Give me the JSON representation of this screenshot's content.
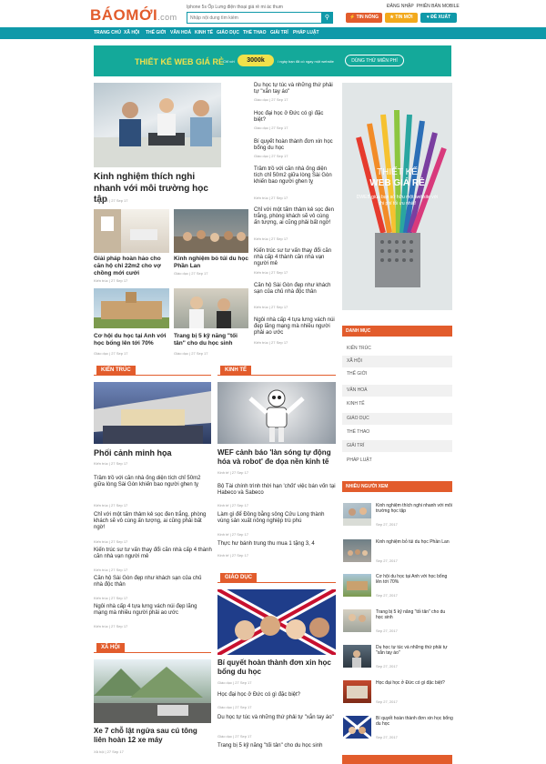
{
  "header": {
    "logo_main": "BÁOMỚI",
    "logo_suffix": ".com",
    "tagline": "Iphone 5s Ốp Lưng điện thoại giá rẻ mi ác thum",
    "search_placeholder": "Nhập nội dung tìm kiếm",
    "hot_btn": "TIN NÓNG",
    "new_btn": "TIN MỚI",
    "suggest_btn": "ĐỀ XUẤT",
    "login": "ĐĂNG NHẬP",
    "mobile": "PHIÊN BẢN MOBILE"
  },
  "nav": [
    "TRANG CHỦ",
    "XÃ HỘI",
    "THẾ GIỚI",
    "VĂN HOÁ",
    "KINH TẾ",
    "GIÁO DỤC",
    "THỂ THAO",
    "GIẢI TRÍ",
    "PHÁP LUẬT"
  ],
  "banner": {
    "title": "THIẾT KẾ WEB GIÁ RẺ",
    "from": "Chỉ với",
    "price": "3000k",
    "note": "/ ngày bạn đã có ngay một website",
    "cta": "DÙNG THỬ MIỄN PHÍ"
  },
  "featured": {
    "title": "Kinh nghiệm thích nghi nhanh với môi trường học tập",
    "meta": "Giáo dục  |  27 Sep 17"
  },
  "small_cards": [
    {
      "title": "Giải pháp hoàn hảo cho căn hộ chỉ 22m2 cho vợ chồng mới cưới",
      "meta": "Kiến trúc  |  27 Sep 17"
    },
    {
      "title": "Kinh nghiệm bỏ túi du học Phần Lan",
      "meta": "Giáo dục  |  27 Sep 17"
    },
    {
      "title": "Cơ hội du học tại Anh với học bổng lên tới 70%",
      "meta": "Giáo dục  |  27 Sep 17"
    },
    {
      "title": "Trang bị 5 kỹ năng \"tối tân\" cho du học sinh",
      "meta": "Giáo dục  |  27 Sep 17"
    }
  ],
  "mid_list": [
    {
      "title": "Du học tự túc và những thứ phải tự \"xắn tay áo\"",
      "meta": "Giáo dục  |  27 Sep 17"
    },
    {
      "title": "Học đại học ở Đức có gì đặc biệt?",
      "meta": "Giáo dục  |  27 Sep 17"
    },
    {
      "title": "Bí quyết hoàn thành đơn xin học bổng du học",
      "meta": "Giáo dục  |  27 Sep 17"
    },
    {
      "title": "Trầm trồ với căn nhà ống diện tích chỉ 50m2 giữa lòng Sài Gòn khiến bao người ghen tỵ",
      "meta": "Kiến trúc  |  27 Sep 17"
    },
    {
      "title": "Chỉ với một tấm thảm kẻ sọc đen trắng, phòng khách sẽ vô cùng ấn tượng, ai cũng phải bất ngờ!",
      "meta": "Kiến trúc  |  27 Sep 17"
    },
    {
      "title": "Kiến trúc sư tư vấn thay đổi căn nhà cấp 4 thành căn nhà vạn người mê",
      "meta": "Kiến trúc  |  27 Sep 17"
    },
    {
      "title": "Căn hộ Sài Gòn đẹp như khách sạn của chủ nhà độc thân",
      "meta": "Kiến trúc  |  27 Sep 17"
    },
    {
      "title": "Ngôi nhà cấp 4 tựa lưng vách núi đẹp lãng mạng mà nhiều người phải ao ước",
      "meta": "Kiến trúc  |  27 Sep 17"
    }
  ],
  "sec_kientruc": {
    "label": "KIẾN TRÚC",
    "lead": "Phối cảnh minh họa",
    "lead_meta": "Kiến trúc  |  27 Sep 17",
    "items": [
      {
        "title": "Trầm trồ với căn nhà ống diện tích chỉ 50m2 giữa lòng Sài Gòn khiến bao người ghen tỵ",
        "meta": "Kiến trúc  |  27 Sep 17"
      },
      {
        "title": "Chỉ với một tấm thảm kẻ sọc đen trắng, phòng khách sẽ vô cùng ấn tượng, ai cũng phải bất ngờ!",
        "meta": "Kiến trúc  |  27 Sep 17"
      },
      {
        "title": "Kiến trúc sư tư vấn thay đổi căn nhà cấp 4 thành căn nhà vạn người mê",
        "meta": "Kiến trúc  |  27 Sep 17"
      },
      {
        "title": "Căn hộ Sài Gòn đẹp như khách sạn của chủ nhà độc thân",
        "meta": "Kiến trúc  |  27 Sep 17"
      },
      {
        "title": "Ngôi nhà cấp 4 tựa lưng vách núi đẹp lãng mạng mà nhiều người phải ao ước",
        "meta": "Kiến trúc  |  27 Sep 17"
      }
    ]
  },
  "sec_kinhte": {
    "label": "KINH TẾ",
    "lead": "WEF cảnh báo 'làn sóng tự động hóa và robot' đe dọa nền kinh tế",
    "lead_meta": "Kinh tế  |  27 Sep 17",
    "items": [
      {
        "title": "Bộ Tài chính trình thời hạn 'chốt' việc bán vốn tại Habeco và Sabeco",
        "meta": "Kinh tế  |  27 Sep 17"
      },
      {
        "title": "Làm gì để Đồng bằng sông Cửu Long thành vùng sản xuất nông nghiệp trù phú",
        "meta": "Kinh tế  |  27 Sep 17"
      },
      {
        "title": "Thực hư bánh trung thu mua 1 tặng 3, 4",
        "meta": "Kinh tế  |  27 Sep 17"
      }
    ]
  },
  "sec_giaoduc": {
    "label": "GIÁO DỤC",
    "lead": "Bí quyết hoàn thành đơn xin học bổng du học",
    "lead_meta": "Giáo dục  |  27 Sep 17",
    "items": [
      {
        "title": "Học đại học ở Đức có gì đặc biệt?",
        "meta": "Giáo dục  |  27 Sep 17"
      },
      {
        "title": "Du học tự túc và những thứ phải tự \"xắn tay áo\"",
        "meta": "Giáo dục  |  27 Sep 17"
      },
      {
        "title": "Trang bị 5 kỹ năng \"tối tân\" cho du học sinh",
        "meta": ""
      }
    ]
  },
  "sec_xahoi": {
    "label": "XÃ HỘI",
    "lead": "Xe 7 chỗ lật ngửa sau cú tông liên hoàn 12 xe máy",
    "lead_meta": "Xã hội  |  27 Sep 17"
  },
  "side_ad": {
    "line1": "THIẾT KẾ",
    "line2": "WEB GIÁ RẺ",
    "desc": "DWEB giúa bạn sở hữu một website với chi phí tối ưu nhất!"
  },
  "danhmuc": {
    "title": "DANH MỤC",
    "items": [
      "KIẾN TRÚC",
      "XÃ HỘI",
      "THẾ GIỚI",
      "VĂN HOÁ",
      "KINH TẾ",
      "GIÁO DỤC",
      "THỂ THAO",
      "GIẢI TRÍ",
      "PHÁP LUẬT"
    ]
  },
  "nhieuxem": {
    "title": "NHIỀU NGƯỜI XEM",
    "items": [
      {
        "title": "Kinh nghiệm thích nghi nhanh với môi trường học tập",
        "date": "Sep 27, 2017"
      },
      {
        "title": "Kinh nghiệm bỏ túi du học Phần Lan",
        "date": "Sep 27, 2017"
      },
      {
        "title": "Cơ hội du học tại Anh với học bổng lên tới 70%",
        "date": "Sep 27, 2017"
      },
      {
        "title": "Trang bị 5 kỹ năng \"tối tân\" cho du học sinh",
        "date": "Sep 27, 2017"
      },
      {
        "title": "Du học tự túc và những thứ phải tự \"xắn tay áo\"",
        "date": "Sep 27, 2017"
      },
      {
        "title": "Học đại học ở Đức có gì đặc biệt?",
        "date": "Sep 27, 2017"
      },
      {
        "title": "Bí quyết hoàn thành đơn xin học bổng du học",
        "date": "Sep 27, 2017"
      }
    ]
  },
  "colors": {
    "teal": "#0f99a9",
    "orange": "#e25c2c",
    "yellow": "#f1e14b"
  }
}
